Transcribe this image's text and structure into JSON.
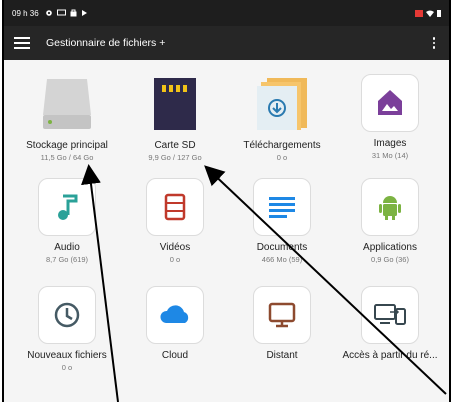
{
  "statusbar": {
    "time": "09 h 36"
  },
  "appbar": {
    "title": "Gestionnaire de fichiers +"
  },
  "tiles": [
    {
      "label": "Stockage principal",
      "sub": "11,5 Go / 64 Go",
      "icon": "drive-icon"
    },
    {
      "label": "Carte SD",
      "sub": "9,9 Go / 127 Go",
      "icon": "sd-card-icon"
    },
    {
      "label": "Téléchargements",
      "sub": "0 o",
      "icon": "download-folder-icon"
    },
    {
      "label": "Images",
      "sub": "31 Mo (14)",
      "icon": "image-icon"
    },
    {
      "label": "Audio",
      "sub": "8,7 Go (619)",
      "icon": "music-icon"
    },
    {
      "label": "Vidéos",
      "sub": "0 o",
      "icon": "film-icon"
    },
    {
      "label": "Documents",
      "sub": "466 Mo (59)",
      "icon": "document-icon"
    },
    {
      "label": "Applications",
      "sub": "0,9 Go (36)",
      "icon": "android-icon"
    },
    {
      "label": "Nouveaux fichiers",
      "sub": "0 o",
      "icon": "clock-icon"
    },
    {
      "label": "Cloud",
      "sub": "",
      "icon": "cloud-icon"
    },
    {
      "label": "Distant",
      "sub": "",
      "icon": "monitor-icon"
    },
    {
      "label": "Accès à partir du ré...",
      "sub": "",
      "icon": "devices-icon"
    }
  ],
  "colors": {
    "statusbar": "#1e1e1e",
    "appbar": "#262626",
    "accent": "#1e88e5"
  }
}
